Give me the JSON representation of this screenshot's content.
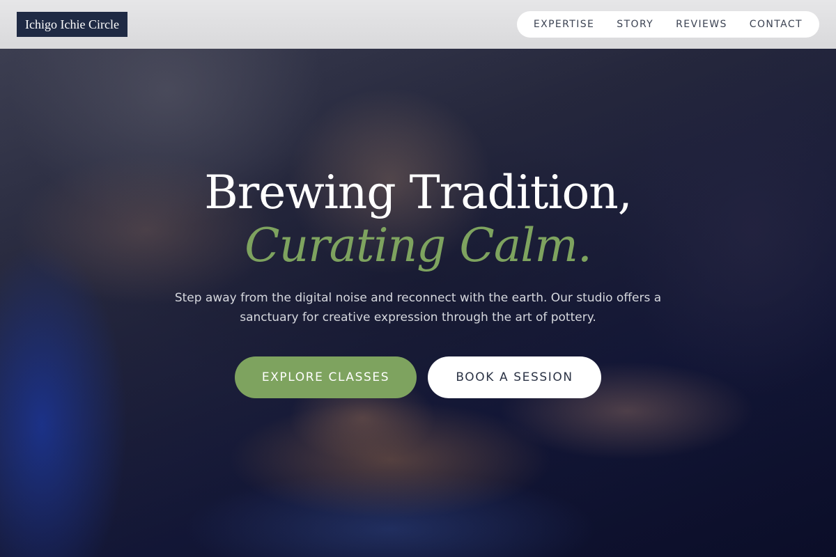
{
  "brand": {
    "name": "Ichigo Ichie Circle"
  },
  "nav": {
    "items": [
      {
        "label": "EXPERTISE"
      },
      {
        "label": "STORY"
      },
      {
        "label": "REVIEWS"
      },
      {
        "label": "CONTACT"
      }
    ]
  },
  "hero": {
    "headline_line1": "Brewing Tradition,",
    "headline_line2": "Curating Calm.",
    "subtext": "Step away from the digital noise and reconnect with the earth. Our studio offers a sanctuary for creative expression through the art of pottery.",
    "primary_cta": "EXPLORE CLASSES",
    "secondary_cta": "BOOK A SESSION"
  },
  "colors": {
    "accent_green": "#7ea35f",
    "brand_navy": "#1f2a44",
    "header_bg": "#e0e0e2"
  }
}
